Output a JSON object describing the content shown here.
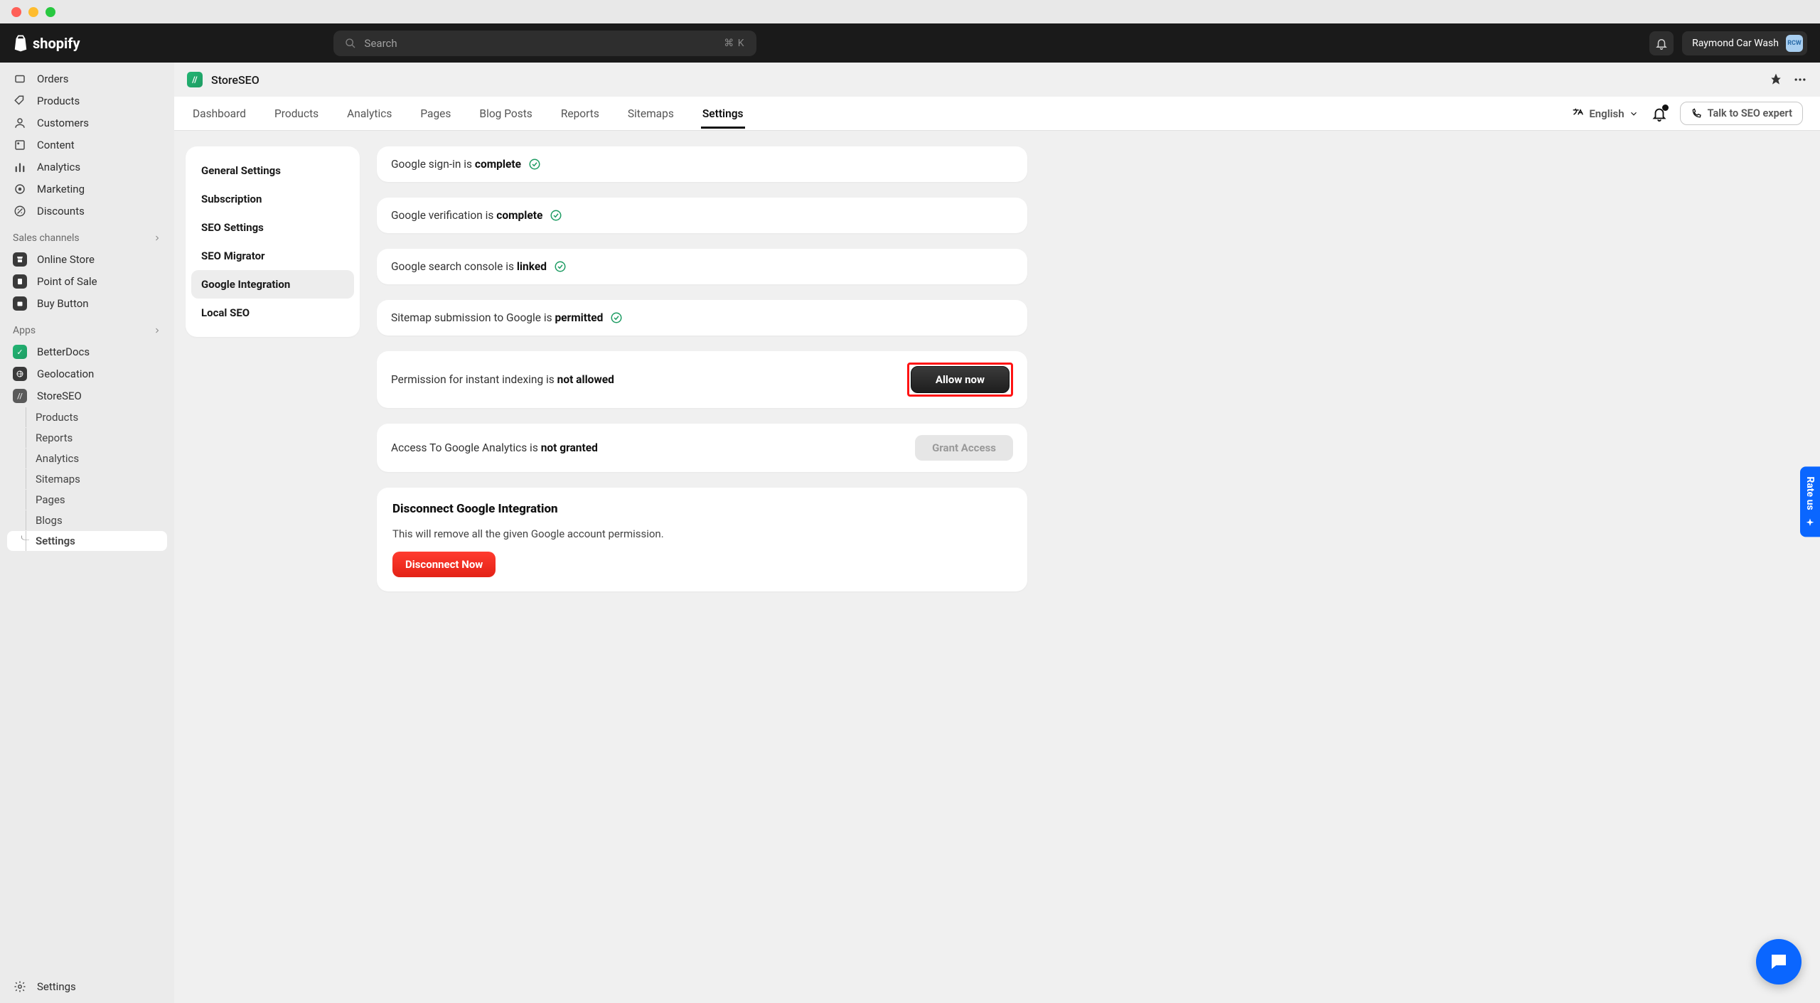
{
  "window": {
    "traffic_lights": [
      "red",
      "yellow",
      "green"
    ]
  },
  "header": {
    "brand": "shopify",
    "search_placeholder": "Search",
    "search_shortcut": "⌘ K",
    "account_name": "Raymond Car Wash",
    "account_initials": "RCW"
  },
  "sidebar": {
    "primary": [
      {
        "icon": "orders",
        "label": "Orders"
      },
      {
        "icon": "products",
        "label": "Products"
      },
      {
        "icon": "customers",
        "label": "Customers"
      },
      {
        "icon": "content",
        "label": "Content"
      },
      {
        "icon": "analytics",
        "label": "Analytics"
      },
      {
        "icon": "marketing",
        "label": "Marketing"
      },
      {
        "icon": "discounts",
        "label": "Discounts"
      }
    ],
    "sales_channels_label": "Sales channels",
    "channels": [
      {
        "icon": "store",
        "label": "Online Store"
      },
      {
        "icon": "pos",
        "label": "Point of Sale"
      },
      {
        "icon": "buy",
        "label": "Buy Button"
      }
    ],
    "apps_label": "Apps",
    "apps": [
      {
        "icon": "betterdocs",
        "label": "BetterDocs"
      },
      {
        "icon": "geolocation",
        "label": "Geolocation"
      },
      {
        "icon": "storeseo",
        "label": "StoreSEO",
        "selected": true
      }
    ],
    "app_sub": [
      {
        "label": "Products"
      },
      {
        "label": "Reports"
      },
      {
        "label": "Analytics"
      },
      {
        "label": "Sitemaps"
      },
      {
        "label": "Pages"
      },
      {
        "label": "Blogs"
      },
      {
        "label": "Settings",
        "active": true
      }
    ],
    "footer": {
      "icon": "settings",
      "label": "Settings"
    }
  },
  "app": {
    "name": "StoreSEO",
    "tabs": [
      "Dashboard",
      "Products",
      "Analytics",
      "Pages",
      "Blog Posts",
      "Reports",
      "Sitemaps",
      "Settings"
    ],
    "active_tab": "Settings",
    "language": "English",
    "talk_label": "Talk to SEO expert"
  },
  "settings_menu": [
    "General Settings",
    "Subscription",
    "SEO Settings",
    "SEO Migrator",
    "Google Integration",
    "Local SEO"
  ],
  "settings_active": "Google Integration",
  "cards": {
    "signin": {
      "pre": "Google sign-in is ",
      "strong": "complete",
      "status": "ok"
    },
    "verify": {
      "pre": "Google verification is ",
      "strong": "complete",
      "status": "ok"
    },
    "console": {
      "pre": "Google search console is ",
      "strong": "linked",
      "status": "ok"
    },
    "sitemap": {
      "pre": "Sitemap submission to Google is ",
      "strong": "permitted",
      "status": "ok"
    },
    "indexing": {
      "pre": "Permission for instant indexing is ",
      "strong": "not allowed",
      "action": "Allow now",
      "highlighted": true
    },
    "analytics": {
      "pre": "Access To Google Analytics is ",
      "strong": "not granted",
      "action": "Grant Access",
      "disabled": true
    },
    "disconnect": {
      "title": "Disconnect Google Integration",
      "desc": "This will remove all the given Google account permission.",
      "action": "Disconnect Now"
    }
  },
  "rate_us": "Rate us",
  "colors": {
    "brand_blue": "#0a66ff",
    "danger": "#e32216",
    "ok": "#1e9c63"
  }
}
